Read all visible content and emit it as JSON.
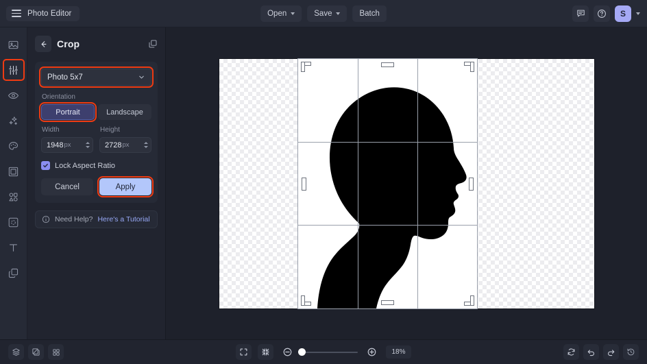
{
  "app": {
    "title": "Photo Editor",
    "accent_red": "#ef3b12",
    "accent_apply": "#b3c7fb",
    "accent_selected": "#3d3f6e",
    "avatar_bg": "#a5a9f5"
  },
  "topbar": {
    "menu_icon": "hamburger-icon",
    "buttons": [
      {
        "label": "Open",
        "has_caret": true
      },
      {
        "label": "Save",
        "has_caret": true
      },
      {
        "label": "Batch",
        "has_caret": false
      }
    ],
    "right_icons": [
      "comment-icon",
      "help-icon"
    ],
    "avatar_initial": "S"
  },
  "rail": {
    "items": [
      {
        "name": "image-icon",
        "active": false
      },
      {
        "name": "adjustments-icon",
        "active": true
      },
      {
        "name": "eye-icon",
        "active": false
      },
      {
        "name": "sparkle-icon",
        "active": false
      },
      {
        "name": "palette-icon",
        "active": false
      },
      {
        "name": "frame-icon",
        "active": false
      },
      {
        "name": "shapes-icon",
        "active": false
      },
      {
        "name": "retouch-icon",
        "active": false
      },
      {
        "name": "text-icon",
        "active": false
      },
      {
        "name": "layers-icon",
        "active": false
      }
    ]
  },
  "panel": {
    "back_icon": "back-arrow-icon",
    "title": "Crop",
    "duplicate_icon": "duplicate-icon",
    "aspect": {
      "label": "aspect-ratio-select",
      "value": "Photo 5x7",
      "highlighted": true
    },
    "orientation": {
      "label": "Orientation",
      "options": [
        "Portrait",
        "Landscape"
      ],
      "selected": "Portrait",
      "highlighted": true
    },
    "width": {
      "label": "Width",
      "value": "1948",
      "unit": "px"
    },
    "height": {
      "label": "Height",
      "value": "2728",
      "unit": "px"
    },
    "lock_aspect": {
      "label": "Lock Aspect Ratio",
      "checked": true
    },
    "cancel_label": "Cancel",
    "apply_label": "Apply",
    "apply_highlighted": true,
    "help": {
      "icon": "info-icon",
      "text": "Need Help?",
      "link": "Here's a Tutorial"
    }
  },
  "canvas": {
    "subject": "head-profile-silhouette",
    "crop_overlay": "rule-of-thirds-grid",
    "transparency_checkerboard": true
  },
  "bottombar": {
    "left_icons": [
      "layers-stack-icon",
      "compare-icon",
      "grid-view-icon"
    ],
    "fit_icon": "fit-screen-icon",
    "shrink_icon": "shrink-icon",
    "zoom_out_icon": "zoom-out-icon",
    "zoom_in_icon": "zoom-in-icon",
    "zoom_level": "18%",
    "right_icons": [
      "rotate-icon",
      "undo-icon",
      "redo-icon",
      "history-icon"
    ]
  }
}
